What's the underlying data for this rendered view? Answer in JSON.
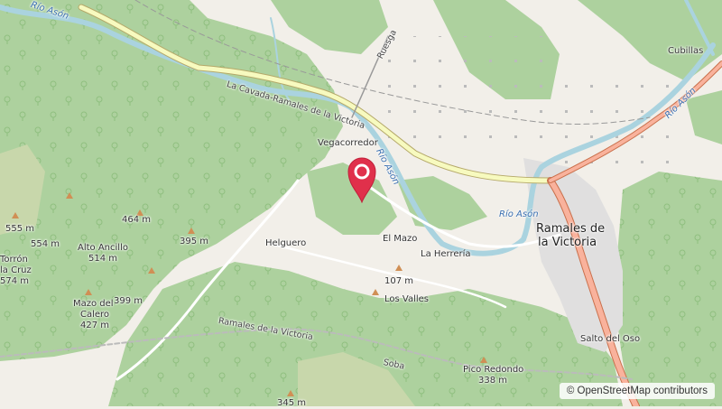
{
  "map": {
    "places": {
      "cubillas": "Cubillas",
      "vegacorredor": "Vegacorredor",
      "helguero": "Helguero",
      "el_mazo": "El Mazo",
      "la_herreria": "La Herrería",
      "los_valles": "Los Valles",
      "salto_del_oso": "Salto del Oso",
      "ramales_line1": "Ramales de",
      "ramales_line2": "la Victoria"
    },
    "roads": {
      "la_cavada": "La Cavada-Ramales de la Victoria",
      "ruesga": "Ruesga",
      "soba": "Soba",
      "ramales_boundary": "Ramales de la Victoria"
    },
    "water": {
      "rio_ason_topleft": "Río Asón",
      "rio_ason_mid": "Río Asón",
      "rio_ason_town": "Río Asón",
      "rio_ason_right": "Río Asón"
    },
    "peaks": {
      "p555": "555 m",
      "p554": "554 m",
      "p464": "464 m",
      "alto_ancillo": "Alto Ancillo",
      "alto_ancillo_elev": "514 m",
      "p395": "395 m",
      "torron_l1": "Torrón",
      "torron_l2": "la Cruz",
      "torron_elev": "574 m",
      "mazo_l1": "Mazo del",
      "mazo_l2": "Calero",
      "mazo_elev": "427 m",
      "p399": "399 m",
      "p107": "107 m",
      "pico_redondo": "Pico Redondo",
      "pico_redondo_elev": "338 m",
      "p345": "345 m"
    },
    "attribution": "© OpenStreetMap contributors",
    "colors": {
      "forest": "#add19e",
      "land": "#f2efe9",
      "water": "#aad3df",
      "road_primary": "#f7fabf",
      "road_trunk": "#f9b29c",
      "marker": "#e0304b"
    }
  }
}
